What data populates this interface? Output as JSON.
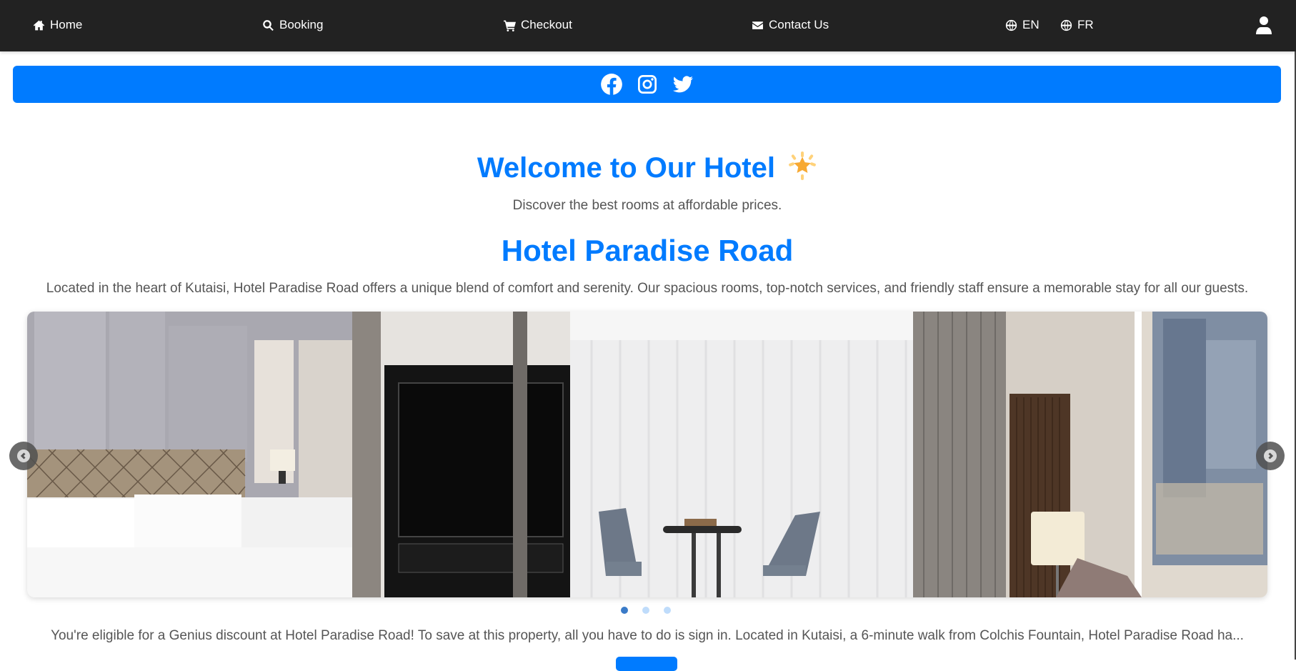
{
  "navbar": {
    "items": [
      {
        "label": "Home",
        "icon": "home-icon"
      },
      {
        "label": "Booking",
        "icon": "search-icon"
      },
      {
        "label": "Checkout",
        "icon": "cart-icon"
      },
      {
        "label": "Contact Us",
        "icon": "envelope-icon"
      }
    ],
    "languages": [
      {
        "label": "EN",
        "icon": "globe-icon"
      },
      {
        "label": "FR",
        "icon": "globe-icon"
      }
    ],
    "user_icon": "user-icon"
  },
  "social": {
    "color": "#007bff",
    "links": [
      {
        "name": "Facebook",
        "icon": "facebook-icon"
      },
      {
        "name": "Instagram",
        "icon": "instagram-icon"
      },
      {
        "name": "Twitter",
        "icon": "twitter-icon"
      }
    ]
  },
  "hero": {
    "title": "Welcome to Our Hotel",
    "title_emoji": "star-icon",
    "subtitle": "Discover the best rooms at affordable prices."
  },
  "hotel": {
    "name": "Hotel Paradise Road",
    "description": "Located in the heart of Kutaisi, Hotel Paradise Road offers a unique blend of comfort and serenity. Our spacious rooms, top-notch services, and friendly staff ensure a memorable stay for all our guests."
  },
  "carousel": {
    "image_alt": "Hotel room with bed, TV, seating area and lamp",
    "slide_count": 3,
    "active_slide": 1,
    "prev_icon": "chevron-left-icon",
    "next_icon": "chevron-right-icon"
  },
  "promo": {
    "text": "You're eligible for a Genius discount at Hotel Paradise Road! To save at this property, all you have to do is sign in. Located in Kutaisi, a 6-minute walk from Colchis Fountain, Hotel Paradise Road ha..."
  },
  "colors": {
    "navbar_bg": "#222222",
    "accent": "#007bff",
    "body_text": "#555555"
  }
}
